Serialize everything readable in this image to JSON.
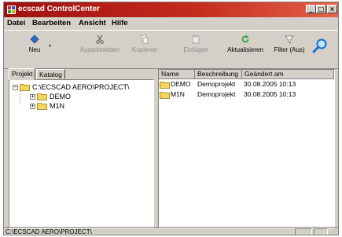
{
  "window": {
    "title": "ecscad ControlCenter"
  },
  "menu": [
    "Datei",
    "Bearbeiten",
    "Ansicht",
    "Hilfe"
  ],
  "toolbar": {
    "new": "Neu",
    "cut": "Ausschneiden",
    "copy": "Kopieren",
    "paste": "Einfügen",
    "refresh": "Aktualisieren",
    "filter": "Filter (Aus)"
  },
  "tabs": [
    "Projekt",
    "Katalog"
  ],
  "tree": {
    "root": "C:\\ECSCAD AERO\\PROJECT\\",
    "children": [
      "DEMO",
      "M1N"
    ]
  },
  "list": {
    "columns": [
      "Name",
      "Beschreibung",
      "Geändert am"
    ],
    "rows": [
      [
        "DEMO",
        "Demoprojekt",
        "30.08.2005 10:13"
      ],
      [
        "M1N",
        "Demoprojekt",
        "30.08.2005 10:13"
      ]
    ]
  },
  "status": {
    "path": "C:\\ECSCAD AERO\\PROJECT\\"
  },
  "colors": {
    "titlebar": "#b01e14",
    "folder": "#f4d35e",
    "window": "#d4d0c8"
  }
}
